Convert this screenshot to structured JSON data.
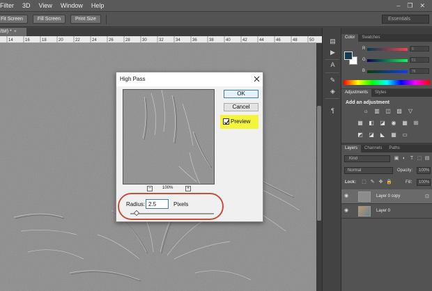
{
  "menubar": {
    "items": [
      "Filter",
      "3D",
      "View",
      "Window",
      "Help"
    ],
    "window_controls": [
      "–",
      "❐",
      "✕"
    ]
  },
  "options_bar": {
    "fit_screen": "Fit Screen",
    "fill_screen": "Fill Screen",
    "print_size": "Print Size",
    "workspace": "Essentials"
  },
  "document_tab": {
    "label": "/8#) *",
    "close": "×"
  },
  "ruler": {
    "labels": [
      "14",
      "16",
      "18",
      "20",
      "22",
      "24",
      "26",
      "28",
      "30",
      "32",
      "34",
      "36",
      "38",
      "40",
      "42",
      "44",
      "46",
      "48",
      "50"
    ]
  },
  "dialog": {
    "title": "High Pass",
    "ok_label": "OK",
    "cancel_label": "Cancel",
    "preview_label": "Preview",
    "preview_checked": true,
    "zoom_out": "−",
    "zoom_level": "100%",
    "zoom_in": "+",
    "radius_label": "Radius:",
    "radius_value": "2.5",
    "radius_unit": "Pixels"
  },
  "color_panel": {
    "tabs": [
      "Color",
      "Swatches"
    ],
    "channels": [
      {
        "name": "R",
        "value": "9"
      },
      {
        "name": "G",
        "value": "51"
      },
      {
        "name": "B",
        "value": "76"
      }
    ],
    "foreground_color": "#123d52",
    "background_color": "#ffffff"
  },
  "adjustments_panel": {
    "tabs": [
      "Adjustments",
      "Styles"
    ],
    "title": "Add an adjustment",
    "row1_icons": [
      "☼",
      "▥",
      "◫",
      "▨",
      "▽"
    ],
    "row2_icons": [
      "▦",
      "◧",
      "◪",
      "◉",
      "▦",
      "⊞"
    ],
    "row3_icons": [
      "◩",
      "◪",
      "◣",
      "▦",
      "▭"
    ]
  },
  "layers_panel": {
    "tabs": [
      "Layers",
      "Channels",
      "Paths"
    ],
    "kind_filter": "Kind",
    "filter_icons": [
      "▣",
      "◐",
      "T",
      "⬚",
      "▤"
    ],
    "blend_mode": "Normal",
    "opacity_label": "Opacity:",
    "opacity_value": "100%",
    "lock_label": "Lock:",
    "lock_icons": [
      "⬚",
      "✎",
      "✥",
      "🔒"
    ],
    "fill_label": "Fill:",
    "fill_value": "100%",
    "layers": [
      {
        "name": "Layer 0 copy",
        "selected": true
      },
      {
        "name": "Layer 0",
        "selected": false
      }
    ],
    "eye_icon": "◉"
  }
}
